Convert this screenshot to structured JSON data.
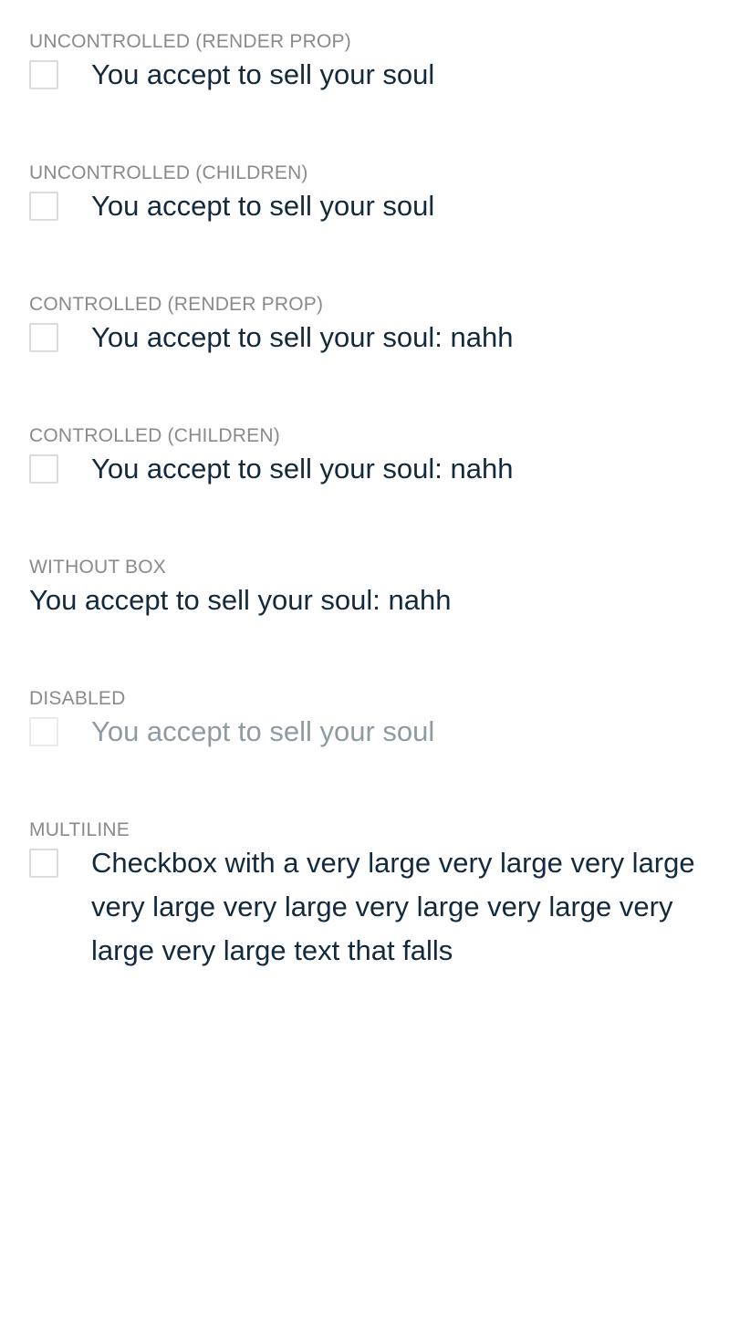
{
  "sections": [
    {
      "label": "UNCONTROLLED (RENDER PROP)",
      "checkbox_text": "You accept to sell your soul",
      "checked": false
    },
    {
      "label": "UNCONTROLLED (CHILDREN)",
      "checkbox_text": "You accept to sell your soul",
      "checked": false
    },
    {
      "label": "CONTROLLED (RENDER PROP)",
      "checkbox_text": "You accept to sell your soul: nahh",
      "checked": false
    },
    {
      "label": "CONTROLLED (CHILDREN)",
      "checkbox_text": "You accept to sell your soul: nahh",
      "checked": false
    },
    {
      "label": "WITHOUT BOX",
      "checkbox_text": "You accept to sell your soul: nahh"
    },
    {
      "label": "DISABLED",
      "checkbox_text": "You accept to sell your soul",
      "checked": false,
      "disabled": true
    },
    {
      "label": "MULTILINE",
      "checkbox_text": "Checkbox with a very large very large very large very large very large very large very large very large very large text that falls",
      "checked": false
    }
  ],
  "colors": {
    "label": "#8a8a8a",
    "text": "#13293d",
    "disabled_text": "#8e9ba3",
    "box_border": "#dcdcdc",
    "background": "#ffffff"
  }
}
